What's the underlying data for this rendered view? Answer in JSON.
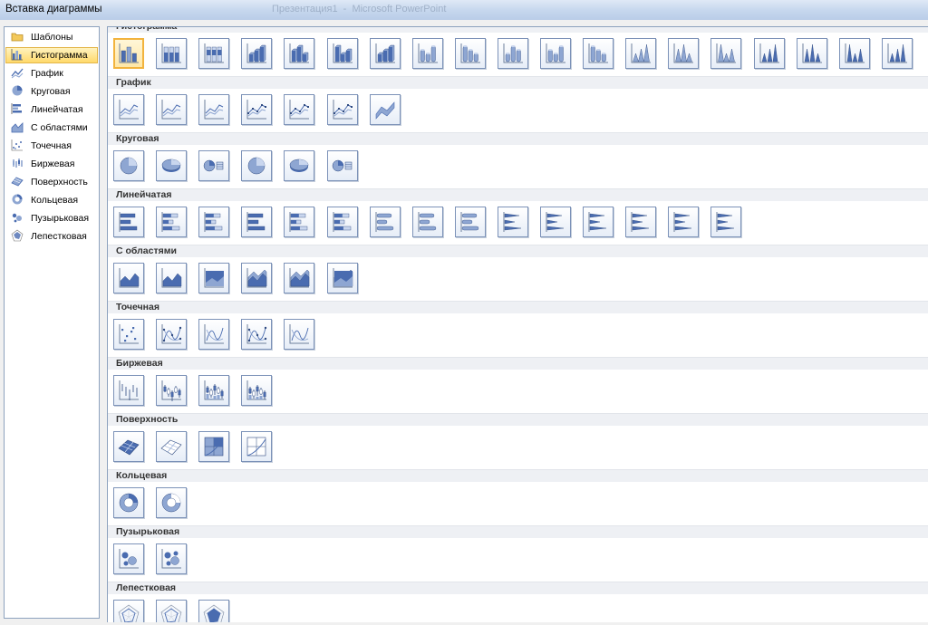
{
  "window": {
    "title": "Вставка диаграммы",
    "app_title": "Презентация1  -  Microsoft PowerPoint"
  },
  "accent": "#4a6cb0",
  "selection_color": "#f2b33d",
  "sidebar": {
    "items": [
      {
        "label": "Шаблоны",
        "icon": "folder-icon",
        "selected": false
      },
      {
        "label": "Гистограмма",
        "icon": "column-chart-icon",
        "selected": true
      },
      {
        "label": "График",
        "icon": "line-chart-icon",
        "selected": false
      },
      {
        "label": "Круговая",
        "icon": "pie-chart-icon",
        "selected": false
      },
      {
        "label": "Линейчатая",
        "icon": "bar-chart-icon",
        "selected": false
      },
      {
        "label": "С областями",
        "icon": "area-chart-icon",
        "selected": false
      },
      {
        "label": "Точечная",
        "icon": "scatter-chart-icon",
        "selected": false
      },
      {
        "label": "Биржевая",
        "icon": "stock-chart-icon",
        "selected": false
      },
      {
        "label": "Поверхность",
        "icon": "surface-chart-icon",
        "selected": false
      },
      {
        "label": "Кольцевая",
        "icon": "doughnut-chart-icon",
        "selected": false
      },
      {
        "label": "Пузырьковая",
        "icon": "bubble-chart-icon",
        "selected": false
      },
      {
        "label": "Лепестковая",
        "icon": "radar-chart-icon",
        "selected": false
      }
    ]
  },
  "gallery": {
    "groups": [
      {
        "key": "column",
        "label": "Гистограмма",
        "count": 19,
        "selected_index": 0
      },
      {
        "key": "line",
        "label": "График",
        "count": 7
      },
      {
        "key": "pie",
        "label": "Круговая",
        "count": 6
      },
      {
        "key": "bar",
        "label": "Линейчатая",
        "count": 15
      },
      {
        "key": "area",
        "label": "С областями",
        "count": 6
      },
      {
        "key": "scatter",
        "label": "Точечная",
        "count": 5
      },
      {
        "key": "stock",
        "label": "Биржевая",
        "count": 4
      },
      {
        "key": "surface",
        "label": "Поверхность",
        "count": 4
      },
      {
        "key": "doughnut",
        "label": "Кольцевая",
        "count": 2
      },
      {
        "key": "bubble",
        "label": "Пузырьковая",
        "count": 2
      },
      {
        "key": "radar",
        "label": "Лепестковая",
        "count": 3
      }
    ]
  }
}
